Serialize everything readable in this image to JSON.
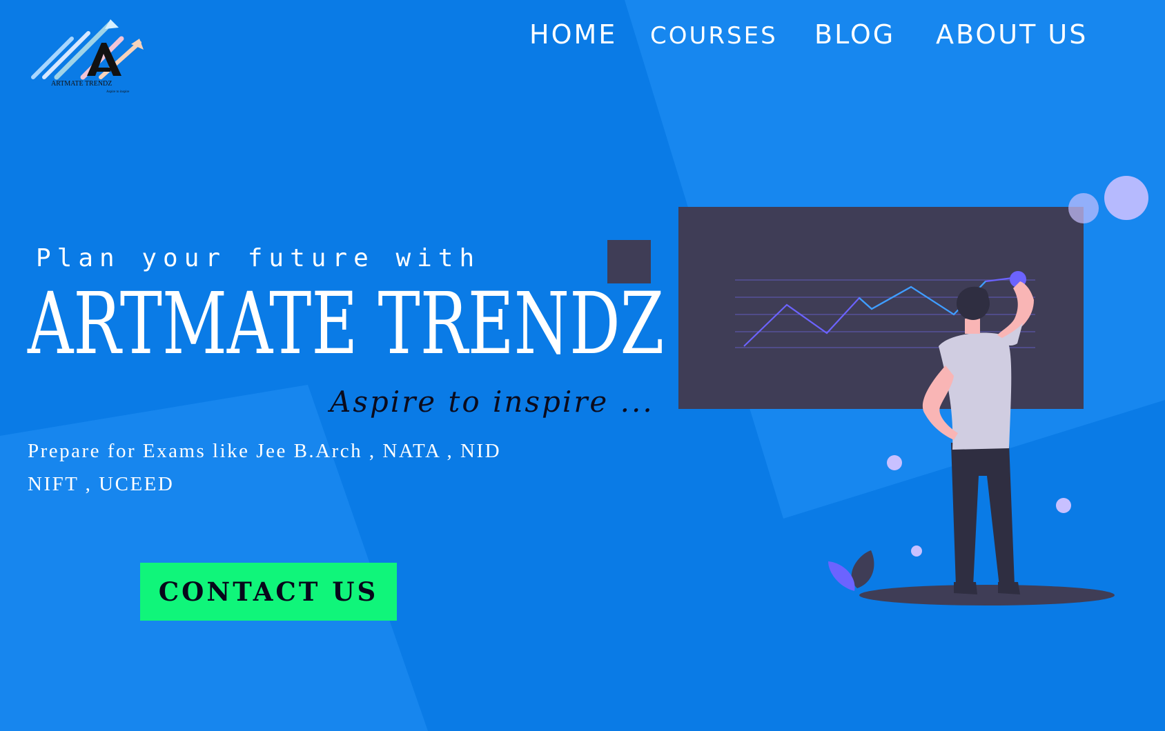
{
  "brand": {
    "logo_text": "ARTMATE TRENDZ",
    "logo_subtext": "Aspire to inspire"
  },
  "nav": {
    "items": [
      {
        "label": "HOME"
      },
      {
        "label": "COURSES"
      },
      {
        "label": "BLOG"
      },
      {
        "label": "ABOUT US"
      }
    ]
  },
  "hero": {
    "tagline": "Plan your future with",
    "title": "ARTMATE TRENDZ",
    "motto": "Aspire to inspire ...",
    "description_line1": "Prepare for Exams like Jee B.Arch , NATA , NID",
    "description_line2": "NIFT , UCEED",
    "cta_label": "CONTACT US"
  },
  "colors": {
    "background": "#0a7be6",
    "background_light": "#1a8af0",
    "cta": "#10f57a",
    "board": "#3f3d56",
    "accent_purple": "#6c63ff",
    "text": "#ffffff"
  },
  "icons": {
    "logo": "arrows-logo-icon",
    "illustration": "man-analyzing-chart-illustration"
  }
}
